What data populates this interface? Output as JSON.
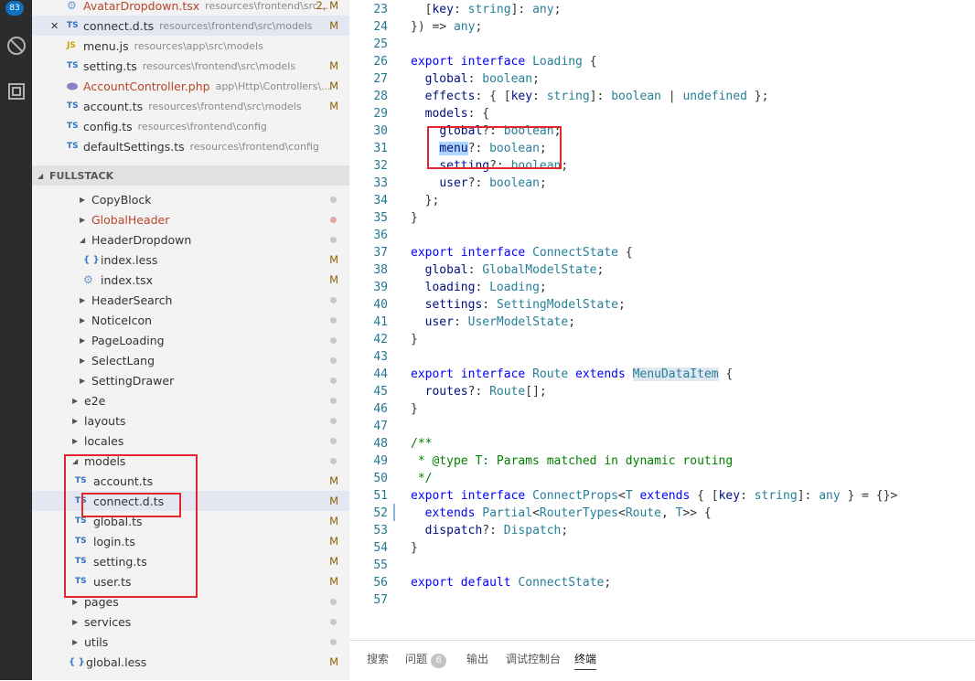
{
  "activity_bar": {
    "badge_count": "83"
  },
  "open_editors": [
    {
      "icon": "gear-icon",
      "name": "AvatarDropdown.tsx",
      "path": "resources\\frontend\\src...",
      "status": "2, M",
      "name_color": "#b8442c"
    },
    {
      "icon": "ts",
      "name": "connect.d.ts",
      "path": "resources\\frontend\\src\\models",
      "status": "M",
      "close": "✕",
      "selected": true
    },
    {
      "icon": "js",
      "name": "menu.js",
      "path": "resources\\app\\src\\models",
      "status": ""
    },
    {
      "icon": "ts",
      "name": "setting.ts",
      "path": "resources\\frontend\\src\\models",
      "status": "M"
    },
    {
      "icon": "php",
      "name": "AccountController.php",
      "path": "app\\Http\\Controllers\\...",
      "status": "M",
      "name_color": "#b8442c"
    },
    {
      "icon": "ts",
      "name": "account.ts",
      "path": "resources\\frontend\\src\\models",
      "status": "M"
    },
    {
      "icon": "ts",
      "name": "config.ts",
      "path": "resources\\frontend\\config",
      "status": ""
    },
    {
      "icon": "ts",
      "name": "defaultSettings.ts",
      "path": "resources\\frontend\\config",
      "status": ""
    }
  ],
  "explorer_section": "FULLSTACK",
  "tree_items": [
    {
      "label": "CopyBlock",
      "kind": "folder"
    },
    {
      "label": "GlobalHeader",
      "kind": "folder",
      "color": "#b8442c"
    },
    {
      "label": "HeaderDropdown",
      "kind": "folder-open"
    },
    {
      "label": "index.less",
      "kind": "less",
      "status": "M"
    },
    {
      "label": "index.tsx",
      "kind": "tsx",
      "status": "M"
    },
    {
      "label": "HeaderSearch",
      "kind": "folder"
    },
    {
      "label": "NoticeIcon",
      "kind": "folder"
    },
    {
      "label": "PageLoading",
      "kind": "folder"
    },
    {
      "label": "SelectLang",
      "kind": "folder"
    },
    {
      "label": "SettingDrawer",
      "kind": "folder"
    },
    {
      "label": "e2e",
      "kind": "folder"
    },
    {
      "label": "layouts",
      "kind": "folder"
    },
    {
      "label": "locales",
      "kind": "folder"
    },
    {
      "label": "models",
      "kind": "folder-open"
    },
    {
      "label": "account.ts",
      "kind": "ts",
      "status": "M"
    },
    {
      "label": "connect.d.ts",
      "kind": "ts",
      "status": "M",
      "selected": true
    },
    {
      "label": "global.ts",
      "kind": "ts",
      "status": "M"
    },
    {
      "label": "login.ts",
      "kind": "ts",
      "status": "M"
    },
    {
      "label": "setting.ts",
      "kind": "ts",
      "status": "M"
    },
    {
      "label": "user.ts",
      "kind": "ts",
      "status": "M"
    },
    {
      "label": "pages",
      "kind": "folder"
    },
    {
      "label": "services",
      "kind": "folder"
    },
    {
      "label": "utils",
      "kind": "folder"
    },
    {
      "label": "global.less",
      "kind": "less-root",
      "status": "M"
    }
  ],
  "code": [
    {
      "n": "23",
      "t": "  [key: string]: any;"
    },
    {
      "n": "24",
      "t": "}) => any;"
    },
    {
      "n": "25",
      "t": ""
    },
    {
      "n": "26",
      "t": "export interface Loading {"
    },
    {
      "n": "27",
      "t": "  global: boolean;"
    },
    {
      "n": "28",
      "t": "  effects: { [key: string]: boolean | undefined };"
    },
    {
      "n": "29",
      "t": "  models: {"
    },
    {
      "n": "30",
      "t": "    global?: boolean;"
    },
    {
      "n": "31",
      "t": "    menu?: boolean;"
    },
    {
      "n": "32",
      "t": "    setting?: boolean;"
    },
    {
      "n": "33",
      "t": "    user?: boolean;"
    },
    {
      "n": "34",
      "t": "  };"
    },
    {
      "n": "35",
      "t": "}"
    },
    {
      "n": "36",
      "t": ""
    },
    {
      "n": "37",
      "t": "export interface ConnectState {"
    },
    {
      "n": "38",
      "t": "  global: GlobalModelState;"
    },
    {
      "n": "39",
      "t": "  loading: Loading;"
    },
    {
      "n": "40",
      "t": "  settings: SettingModelState;"
    },
    {
      "n": "41",
      "t": "  user: UserModelState;"
    },
    {
      "n": "42",
      "t": "}"
    },
    {
      "n": "43",
      "t": ""
    },
    {
      "n": "44",
      "t": "export interface Route extends MenuDataItem {"
    },
    {
      "n": "45",
      "t": "  routes?: Route[];"
    },
    {
      "n": "46",
      "t": "}"
    },
    {
      "n": "47",
      "t": ""
    },
    {
      "n": "48",
      "t": "/**"
    },
    {
      "n": "49",
      "t": " * @type T: Params matched in dynamic routing"
    },
    {
      "n": "50",
      "t": " */"
    },
    {
      "n": "51",
      "t": "export interface ConnectProps<T extends { [key: string]: any } = {}>"
    },
    {
      "n": "52",
      "t": "  extends Partial<RouterTypes<Route, T>> {"
    },
    {
      "n": "53",
      "t": "  dispatch?: Dispatch;"
    },
    {
      "n": "54",
      "t": "}"
    },
    {
      "n": "55",
      "t": ""
    },
    {
      "n": "56",
      "t": "export default ConnectState;"
    },
    {
      "n": "57",
      "t": ""
    }
  ],
  "panel": {
    "tabs": [
      "搜索",
      "问题",
      "输出",
      "调试控制台",
      "终端"
    ],
    "problems_count": "6",
    "active_tab": "终端"
  },
  "colors": {
    "annotation": "#e3262b",
    "line_number": "#237893",
    "keyword": "#0000ff",
    "type": "#267f99"
  }
}
